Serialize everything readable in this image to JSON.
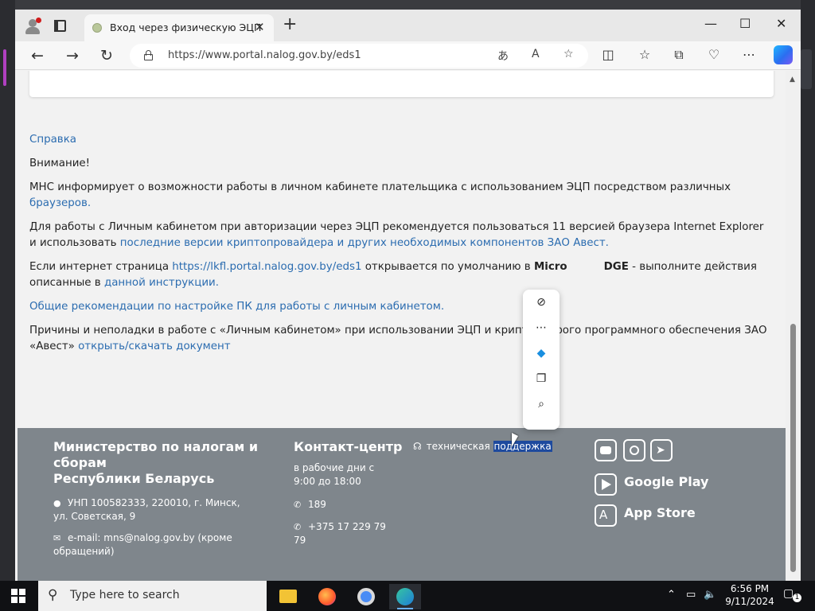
{
  "browser": {
    "tab_title": "Вход через физическую ЭЦП",
    "url": "https://www.portal.nalog.gov.by/eds1",
    "new_tab": "+",
    "tab_close": "✕",
    "minimize": "—",
    "maximize": "☐",
    "close": "✕"
  },
  "content": {
    "help_link": "Справка",
    "attention": "Внимание!",
    "p1_text": "МНС информирует о возможности работы в личном кабинете плательщика с использованием ЭЦП посредством различных ",
    "p1_link": "браузеров.",
    "p2_text": "Для работы с Личным кабинетом при авторизации через ЭЦП рекомендуется пользоваться 11 версией браузера Internet Explorer и использовать ",
    "p2_link": "последние версии криптопровайдера и других необходимых компонентов ЗАО Авест.",
    "p3_text1": "Если интернет страница ",
    "p3_link": "https://lkfl.portal.nalog.gov.by/eds1",
    "p3_text2": " открывается по умолчанию в ",
    "p3_bold": "Micro",
    "p3_bold2": "DGE",
    "p3_text3": " - выполните действия описанные в ",
    "p3_link2": "данной инструкции.",
    "p4_link": "Общие рекомендации по настройке ПК для работы с личным кабинетом.",
    "p5_text": "Причины и неполадки в работе с «Личным кабинетом» при использовании ЭЦП и криптограф",
    "p5_text_b": "ого программного обеспечения ЗАО «Авест» ",
    "p5_link": "открыть/скачать документ"
  },
  "footer": {
    "title_line1": "Министерство по налогам и",
    "title_line2": "сборам",
    "title_line3": "Республики Беларусь",
    "address": "УНП 100582333, 220010, г. Минск, ул. Советская, 9",
    "email": "e-mail: mns@nalog.gov.by (кроме обращений)",
    "contact_title": "Контакт-центр",
    "workdays": "в рабочие дни с 9:00 до 18:00",
    "phone_short": "189",
    "phone_long": "+375 17 229 79 79",
    "support_text": "техническая ",
    "support_highlight": "поддержка",
    "google_play": "Google Play",
    "app_store": "App Store"
  },
  "taskbar": {
    "search_placeholder": "Type here to search",
    "time": "6:56 PM",
    "date": "9/11/2024",
    "notif_count": "1"
  }
}
